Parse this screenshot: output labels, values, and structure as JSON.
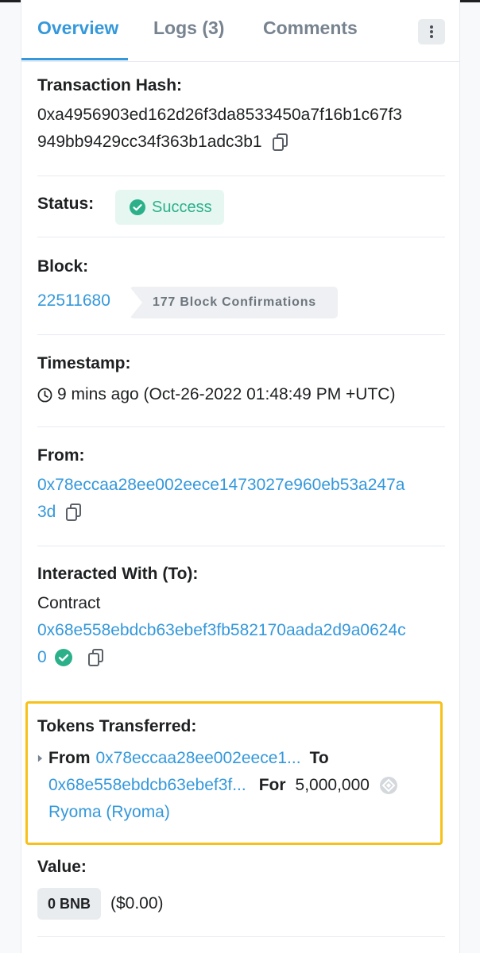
{
  "tabs": [
    {
      "label": "Overview"
    },
    {
      "label": "Logs (3)"
    },
    {
      "label": "Comments"
    }
  ],
  "tx_hash": {
    "label": "Transaction Hash:",
    "line1": "0xa4956903ed162d26f3da8533450a7f16b1c67f3",
    "line2": "949bb9429cc34f363b1adc3b1"
  },
  "status": {
    "label": "Status:",
    "value": "Success"
  },
  "block": {
    "label": "Block:",
    "number": "22511680",
    "confirmations": "177 Block Confirmations"
  },
  "timestamp": {
    "label": "Timestamp:",
    "value": "9 mins ago (Oct-26-2022 01:48:49 PM +UTC)"
  },
  "from": {
    "label": "From:",
    "line1": "0x78eccaa28ee002eece1473027e960eb53a247a",
    "line2": "3d"
  },
  "to": {
    "label": "Interacted With (To):",
    "prefix": "Contract",
    "line1": "0x68e558ebdcb63ebef3fb582170aada2d9a0624c",
    "line2": "0"
  },
  "tokens": {
    "label": "Tokens Transferred:",
    "from_label": "From",
    "from_addr": "0x78eccaa28ee002eece1...",
    "to_label": "To",
    "to_addr": "0x68e558ebdcb63ebef3f...",
    "for_label": "For",
    "amount": "5,000,000",
    "token_name": "Ryoma (Ryoma)"
  },
  "value": {
    "label": "Value:",
    "amount": "0 BNB",
    "usd": "($0.00)"
  },
  "colors": {
    "accent": "#3498db",
    "success": "#2bb08a",
    "highlight": "#f8c11a"
  }
}
